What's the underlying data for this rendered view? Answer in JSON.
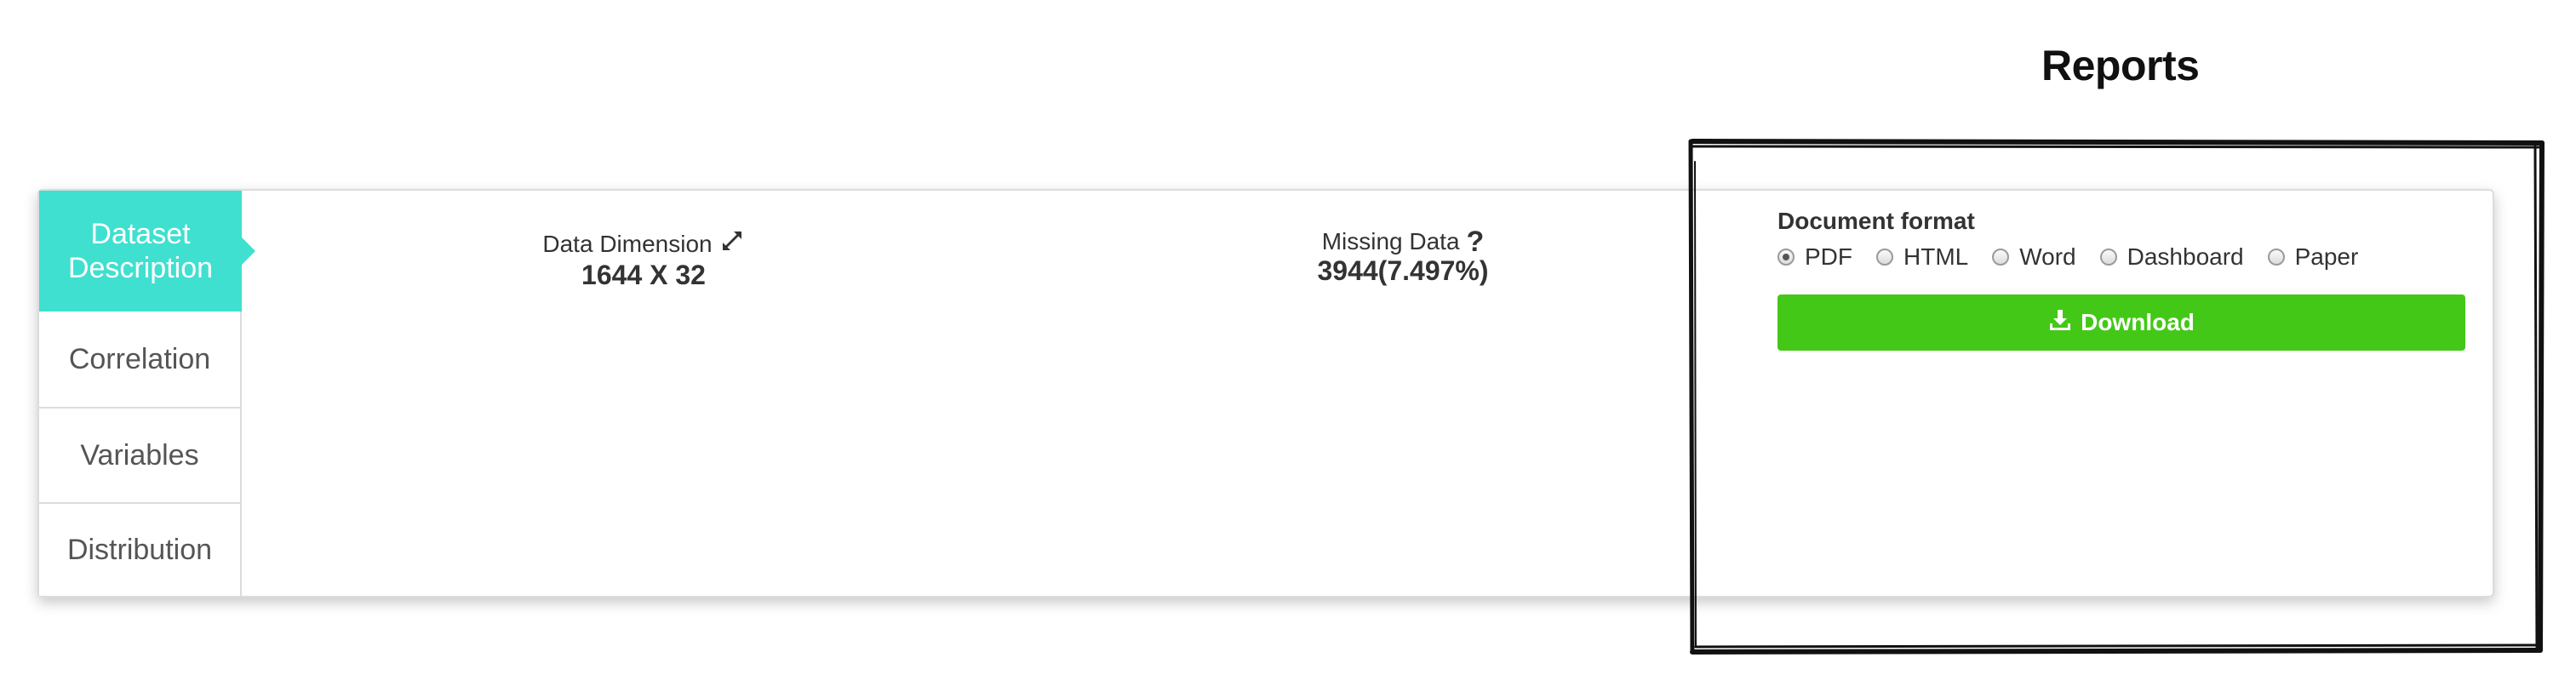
{
  "header": {
    "title": "Reports"
  },
  "nav": {
    "items": [
      {
        "label": "Dataset\nDescription",
        "active": true
      },
      {
        "label": "Correlation",
        "active": false
      },
      {
        "label": "Variables",
        "active": false
      },
      {
        "label": "Distribution",
        "active": false
      }
    ]
  },
  "stats": {
    "dimension": {
      "label": "Data Dimension",
      "value": "1644 X 32",
      "icon": "expand-arrows-icon"
    },
    "missing": {
      "label": "Missing Data",
      "value": "3944(7.497%)",
      "icon": "question-icon"
    }
  },
  "report": {
    "format_label": "Document format",
    "options": [
      "PDF",
      "HTML",
      "Word",
      "Dashboard",
      "Paper"
    ],
    "selected": "PDF",
    "download_label": "Download",
    "download_icon": "download-icon"
  },
  "colors": {
    "nav_active": "#3fe0d0",
    "download": "#44c818"
  }
}
